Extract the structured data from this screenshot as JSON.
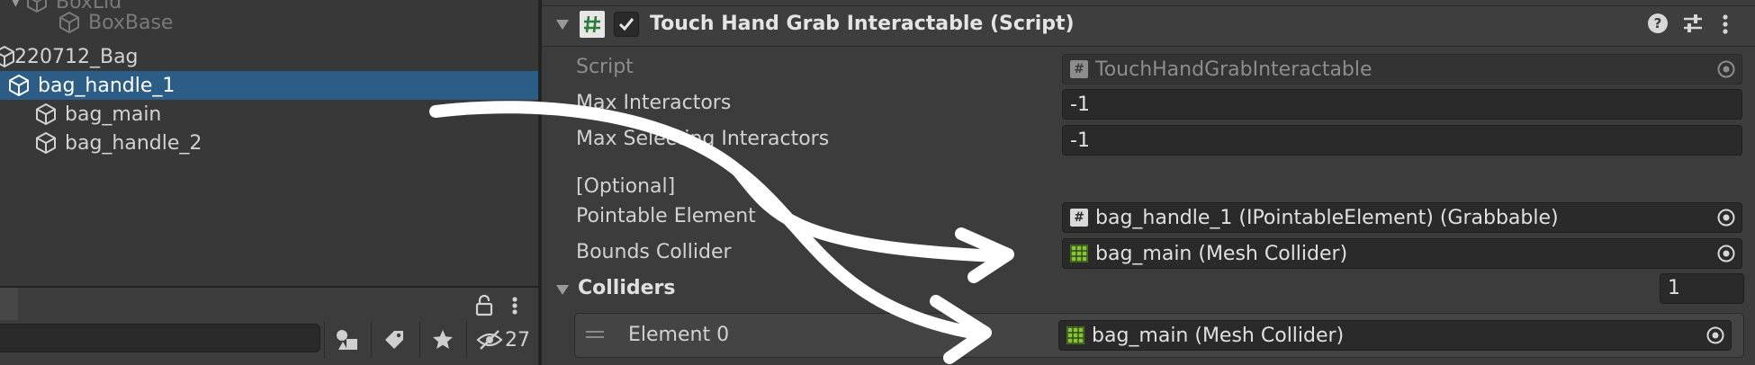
{
  "hierarchy": {
    "items": [
      {
        "label": "BoxLid",
        "dim": true
      },
      {
        "label": "BoxBase",
        "dim": true
      },
      {
        "label": "220712_Bag"
      },
      {
        "label": "bag_handle_1",
        "selected": true
      },
      {
        "label": "bag_main"
      },
      {
        "label": "bag_handle_2"
      }
    ]
  },
  "project_toolbar": {
    "search_value": "",
    "hidden_count": "27",
    "icons": [
      "lock-icon",
      "more-icon",
      "filter-by-type-icon",
      "filter-by-label-icon",
      "favorites-icon",
      "visibility-icon"
    ]
  },
  "component": {
    "title": "Touch Hand Grab Interactable (Script)",
    "enabled": true,
    "icons": [
      "script-hash-icon",
      "help-icon",
      "presets-icon",
      "more-vertical-icon"
    ]
  },
  "fields": {
    "script_label": "Script",
    "script_value": "TouchHandGrabInteractable",
    "max_interactors_label": "Max Interactors",
    "max_interactors_value": "-1",
    "max_selecting_label": "Max Selecting Interactors",
    "max_selecting_value": "-1",
    "optional_header": "[Optional]",
    "pointable_label": "Pointable Element",
    "pointable_value": "bag_handle_1 (IPointableElement) (Grabbable)",
    "bounds_label": "Bounds Collider",
    "bounds_value": "bag_main (Mesh Collider)"
  },
  "colliders": {
    "label": "Colliders",
    "size": "1",
    "elements": [
      {
        "label": "Element 0",
        "value": "bag_main (Mesh Collider)"
      }
    ]
  },
  "colors": {
    "selection": "#2c5d87",
    "panel": "#383838",
    "inspector": "#3c3c3c",
    "field": "#2a2a2a",
    "mesh_icon": "#89c23b"
  }
}
